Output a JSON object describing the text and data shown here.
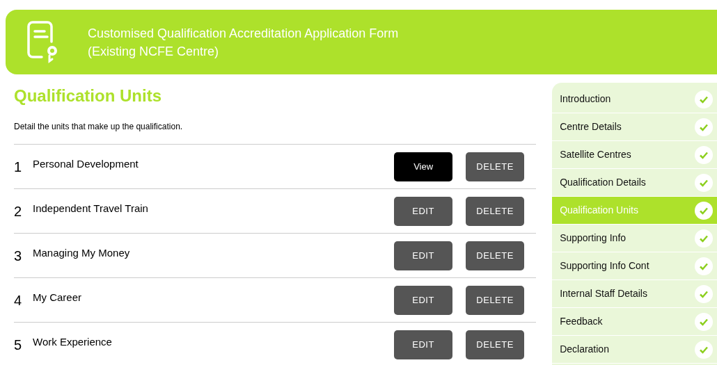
{
  "header": {
    "title_lines": [
      "Customised Qualification Accreditation Application Form",
      "(Existing NCFE Centre)"
    ]
  },
  "heading": "Qualification Units",
  "description": "Detail the units that make up the qualification.",
  "units": [
    {
      "number": "1",
      "name": "Personal Development",
      "action": {
        "kind": "view",
        "label": "View"
      },
      "delete": "DELETE"
    },
    {
      "number": "2",
      "name": "Independent Travel Train",
      "action": {
        "kind": "edit",
        "label": "EDIT"
      },
      "delete": "DELETE"
    },
    {
      "number": "3",
      "name": "Managing My Money",
      "action": {
        "kind": "edit",
        "label": "EDIT"
      },
      "delete": "DELETE"
    },
    {
      "number": "4",
      "name": "My Career",
      "action": {
        "kind": "edit",
        "label": "EDIT"
      },
      "delete": "DELETE"
    },
    {
      "number": "5",
      "name": "Work Experience",
      "action": {
        "kind": "edit",
        "label": "EDIT"
      },
      "delete": "DELETE"
    }
  ],
  "sidebar": {
    "items": [
      {
        "label": "Introduction",
        "selected": false,
        "done": true
      },
      {
        "label": "Centre Details",
        "selected": false,
        "done": true
      },
      {
        "label": "Satellite Centres",
        "selected": false,
        "done": true
      },
      {
        "label": "Qualification Details",
        "selected": false,
        "done": true
      },
      {
        "label": "Qualification Units",
        "selected": true,
        "done": true
      },
      {
        "label": "Supporting Info",
        "selected": false,
        "done": true
      },
      {
        "label": "Supporting Info Cont",
        "selected": false,
        "done": true
      },
      {
        "label": "Internal Staff Details",
        "selected": false,
        "done": true
      },
      {
        "label": "Feedback",
        "selected": false,
        "done": true
      },
      {
        "label": "Declaration",
        "selected": false,
        "done": true
      }
    ]
  }
}
